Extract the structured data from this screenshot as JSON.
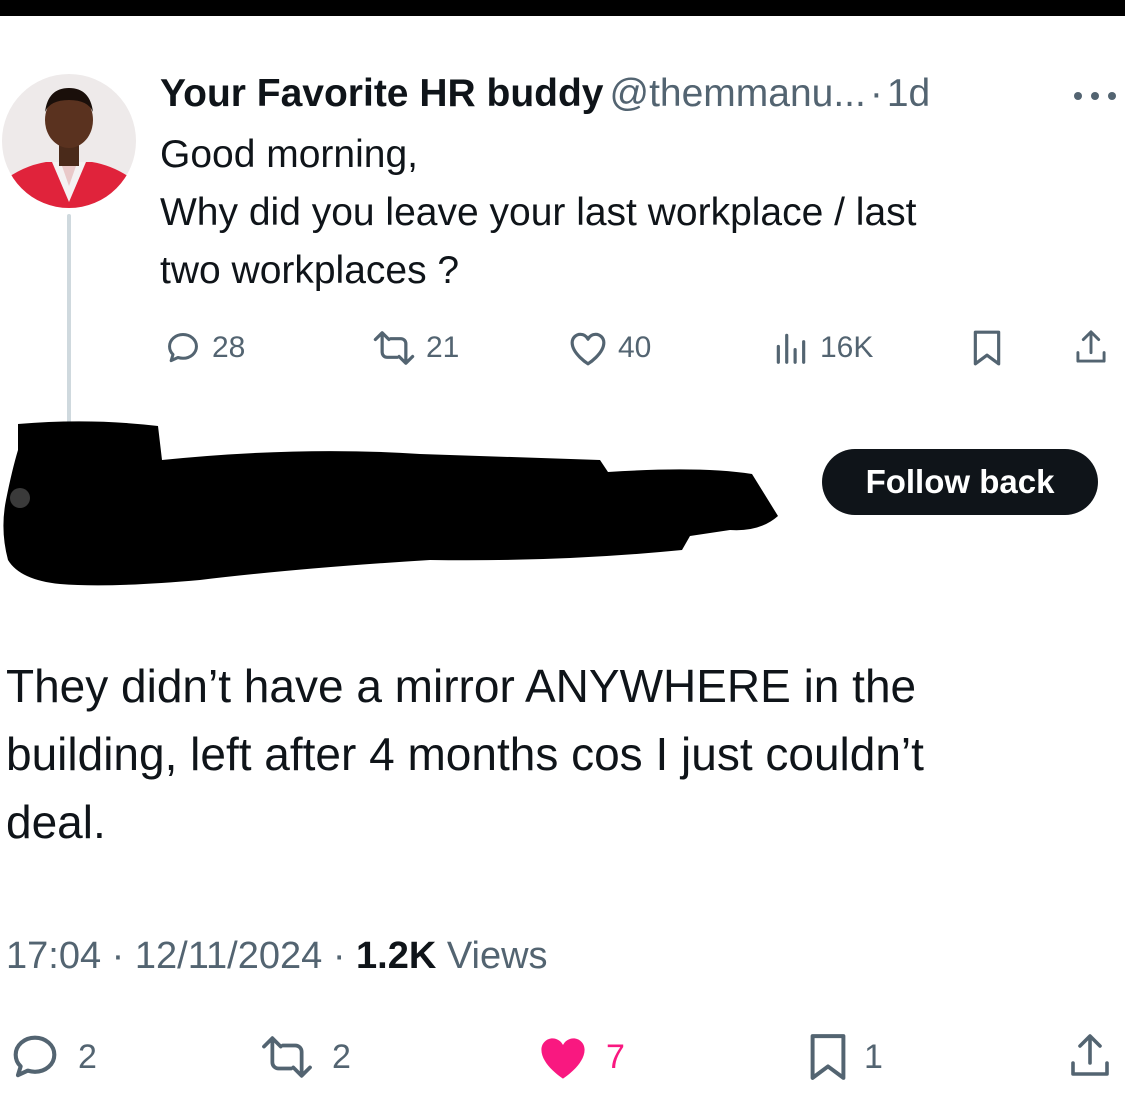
{
  "parent_tweet": {
    "name": "Your Favorite HR buddy",
    "handle": "@themmanu...",
    "separator": "·",
    "time": "1d",
    "text_lines": [
      "Good morning,",
      "Why did you leave your last workplace / last",
      "two workplaces ?"
    ],
    "replies": "28",
    "retweets": "21",
    "likes": "40",
    "views": "16K"
  },
  "reply": {
    "follow_button_label": "Follow back",
    "text_lines": [
      "They didn’t have a mirror ANYWHERE in the",
      "building, left after 4 months cos I just couldn’t",
      "deal."
    ],
    "time": "17:04",
    "date": "12/11/2024",
    "separator": "·",
    "views_count": "1.2K",
    "views_label": "Views",
    "replies": "2",
    "retweets": "2",
    "likes": "7",
    "bookmarks": "1"
  },
  "colors": {
    "text": "#0f1419",
    "secondary": "#536471",
    "like_active": "#f91880",
    "thread_line": "#cfd9de",
    "avatar_jacket": "#e0233b"
  },
  "icons": [
    "reply-icon",
    "retweet-icon",
    "heart-icon",
    "views-icon",
    "bookmark-icon",
    "share-icon",
    "more-icon"
  ]
}
